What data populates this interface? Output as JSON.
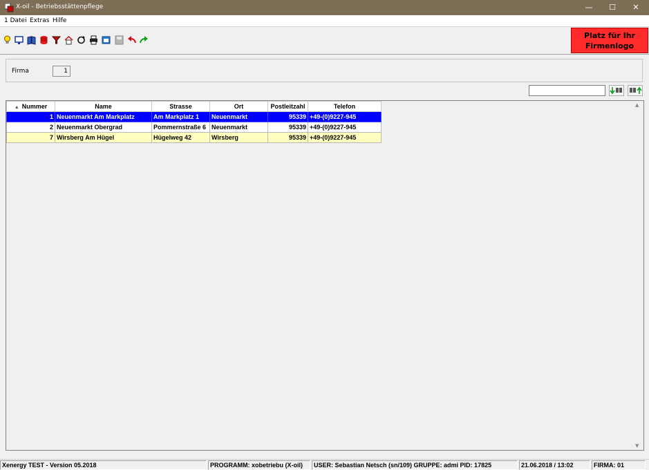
{
  "window": {
    "title": "X-oil - Betriebsstättenpflege",
    "minimize": "—",
    "maximize": "☐",
    "close": "✕"
  },
  "menu": [
    "1 Datei",
    "Extras",
    "Hilfe"
  ],
  "toolbar": {
    "icons": [
      "lightbulb-icon",
      "monitor-book-icon",
      "book-icon",
      "database-icon",
      "filter-icon",
      "home-icon",
      "refresh-icon",
      "print-icon",
      "window-icon",
      "save-icon",
      "undo-icon",
      "redo-icon"
    ]
  },
  "logo": {
    "line1": "Platz für Ihr",
    "line2": "Firmenlogo",
    "color": "#ff2a2a"
  },
  "firma": {
    "label": "Firma",
    "value": "1"
  },
  "search": {
    "value": ""
  },
  "table": {
    "columns": [
      "Nummer",
      "Name",
      "Strasse",
      "Ort",
      "Postleitzahl",
      "Telefon"
    ],
    "rows": [
      {
        "nummer": "1",
        "name": "Neuenmarkt Am Markplatz",
        "strasse": "Am Markplatz 1",
        "ort": "Neuenmarkt",
        "plz": "95339",
        "telefon": "+49-(0)9227-945"
      },
      {
        "nummer": "2",
        "name": "Neuenmarkt Obergrad",
        "strasse": "Pommernstraße 6",
        "ort": "Neuenmarkt",
        "plz": "95339",
        "telefon": "+49-(0)9227-945"
      },
      {
        "nummer": "7",
        "name": "Wirsberg Am Hügel",
        "strasse": "Hügelweg 42",
        "ort": "Wirsberg",
        "plz": "95339",
        "telefon": "+49-(0)9227-945"
      }
    ],
    "selected_color": "#0000ff",
    "alt_color": "#ffffc0"
  },
  "status": {
    "version": "Xenergy TEST - Version 05.2018",
    "programm": "PROGRAMM: xobetriebu (X-oil)",
    "user": "USER: Sebastian Netsch (sn/109)  GRUPPE: admi  PID: 17825",
    "datetime": "21.06.2018 / 13:02",
    "firma": "FIRMA: 01"
  }
}
